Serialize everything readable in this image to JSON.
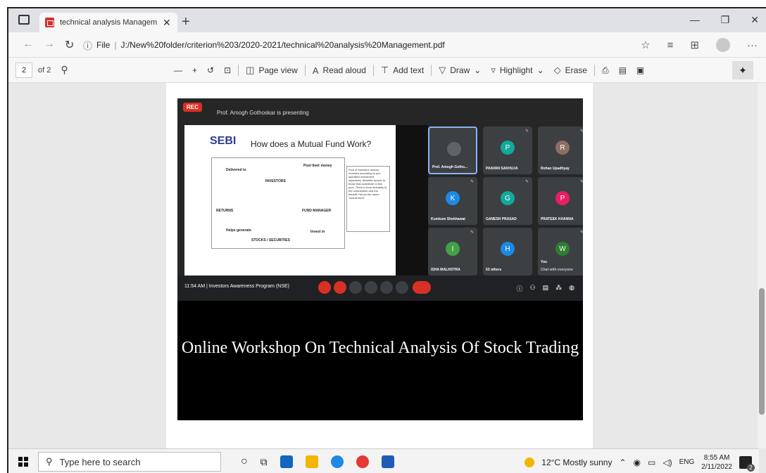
{
  "browser": {
    "tab_title": "technical analysis Management.p",
    "url_prefix": "File",
    "url": "J:/New%20folder/criterion%203/2020-2021/technical%20analysis%20Management.pdf"
  },
  "pdf_toolbar": {
    "page_current": "2",
    "page_total": "of 2",
    "page_view": "Page view",
    "read_aloud": "Read aloud",
    "add_text": "Add text",
    "draw": "Draw",
    "highlight": "Highlight",
    "erase": "Erase"
  },
  "meeting": {
    "rec": "REC",
    "presenting": "Prof. Amogh Gothoskar is presenting",
    "slide_title": "How does a Mutual Fund Work?",
    "slide_logo": "SEBI",
    "slide_labels": [
      "INVESTORS",
      "FUND MANAGER",
      "STOCKS / SECURITIES",
      "RETURNS",
      "Pool their money",
      "Delivered to",
      "Helps generate",
      "Invest in"
    ],
    "slide_notes": "Pool of investors money. Invested according to pre-specified investment objectives. Benefits accrue to those that contribute to this pool. There is thus mutuality in the contribution and the benefit. Hence the name 'mutual fund'.",
    "participants": [
      {
        "name": "Prof. Amogh Gotho...",
        "initial": "",
        "color": "#5f6368"
      },
      {
        "name": "PAAVAN SAKHUJA",
        "initial": "P",
        "color": "#12a89d"
      },
      {
        "name": "Rohan Upadhyay",
        "initial": "R",
        "color": "#8d6e63"
      },
      {
        "name": "Kumkum Shekhawat",
        "initial": "K",
        "color": "#1e88e5"
      },
      {
        "name": "GANESH PRASAD",
        "initial": "G",
        "color": "#12a89d"
      },
      {
        "name": "PRATEEK KHANNA",
        "initial": "P",
        "color": "#e91e63"
      },
      {
        "name": "ISHA MALHOTRA",
        "initial": "I",
        "color": "#43a047"
      },
      {
        "name": "53 others",
        "initial": "H",
        "color": "#1e88e5"
      },
      {
        "name": "You",
        "initial": "W",
        "color": "#2e7d32"
      }
    ],
    "chat_hint": "Chat with everyone",
    "time_label": "11:54 AM | Investors Awareness Program (NSE)"
  },
  "document": {
    "headline": "Online Workshop On Technical Analysis Of Stock Trading"
  },
  "taskbar": {
    "search_placeholder": "Type here to search",
    "weather": "12°C  Mostly sunny",
    "lang": "ENG",
    "time": "8:55 AM",
    "date": "2/11/2022",
    "notif_count": "2"
  }
}
